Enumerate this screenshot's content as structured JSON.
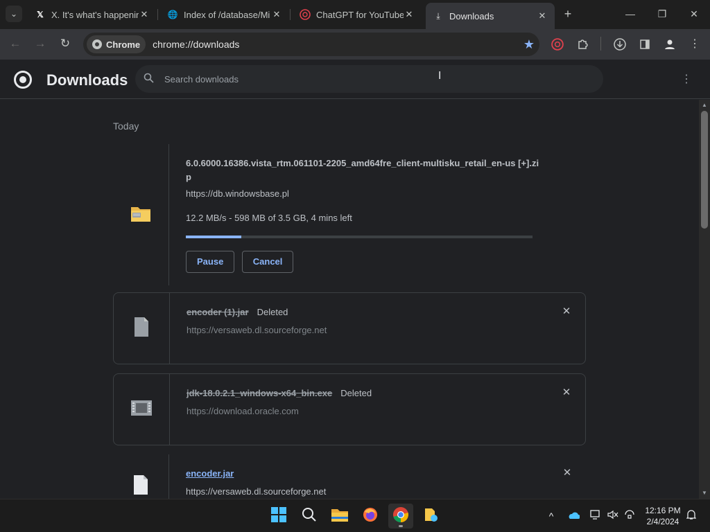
{
  "browser": {
    "tabs": [
      {
        "title": "X. It's what's happening",
        "favicon": "x-logo-icon"
      },
      {
        "title": "Index of /database/Mi",
        "favicon": "globe-icon"
      },
      {
        "title": "ChatGPT for YouTube",
        "favicon": "chatgpt-icon"
      },
      {
        "title": "Downloads",
        "favicon": "download-icon",
        "active": true
      }
    ],
    "chip_label": "Chrome",
    "url": "chrome://downloads"
  },
  "page": {
    "title": "Downloads",
    "search_placeholder": "Search downloads",
    "date_group": "Today"
  },
  "downloads": [
    {
      "name_line1": "6.0.6000.16386.vista_rtm.061101-2205_amd64fre_client-multisku_retail_en-us [+].zi",
      "name_line2": "p",
      "source": "https://db.windowsbase.pl",
      "status": "12.2 MB/s - 598 MB of 3.5 GB, 4 mins left",
      "progress": 0.16,
      "pause_label": "Pause",
      "cancel_label": "Cancel",
      "icon": "zip-folder-icon"
    },
    {
      "name": "encoder (1).jar",
      "tag": "Deleted",
      "source": "https://versaweb.dl.sourceforge.net",
      "icon": "file-icon"
    },
    {
      "name": "jdk-18.0.2.1_windows-x64_bin.exe",
      "tag": "Deleted",
      "source": "https://download.oracle.com",
      "icon": "exe-icon"
    },
    {
      "name": "encoder.jar",
      "source": "https://versaweb.dl.sourceforge.net",
      "icon": "file-icon"
    }
  ],
  "taskbar": {
    "time": "12:16 PM",
    "date": "2/4/2024"
  },
  "colors": {
    "accent": "#8ab4f8",
    "background": "#202124"
  }
}
